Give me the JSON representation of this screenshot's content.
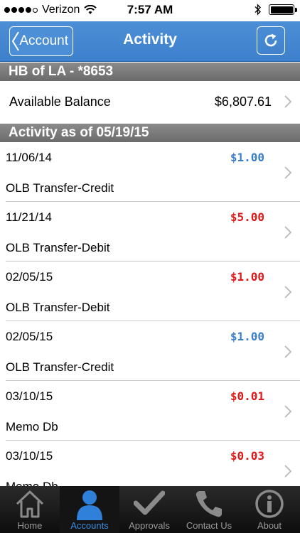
{
  "status_bar": {
    "carrier": "Verizon",
    "time": "7:57 AM"
  },
  "nav": {
    "back_label": "Account",
    "title": "Activity"
  },
  "account_header": "HB of LA - *8653",
  "balance": {
    "label": "Available Balance",
    "value": "$6,807.61"
  },
  "activity_header": "Activity as of 05/19/15",
  "transactions": [
    {
      "date": "11/06/14",
      "description": "OLB Transfer-Credit",
      "amount": "$1.00",
      "type": "credit"
    },
    {
      "date": "11/21/14",
      "description": "OLB Transfer-Debit",
      "amount": "$5.00",
      "type": "debit"
    },
    {
      "date": "02/05/15",
      "description": "OLB Transfer-Debit",
      "amount": "$1.00",
      "type": "debit"
    },
    {
      "date": "02/05/15",
      "description": "OLB Transfer-Credit",
      "amount": "$1.00",
      "type": "credit"
    },
    {
      "date": "03/10/15",
      "description": "Memo Db",
      "amount": "$0.01",
      "type": "debit"
    },
    {
      "date": "03/10/15",
      "description": "Memo Db",
      "amount": "$0.03",
      "type": "debit"
    }
  ],
  "tabs": [
    {
      "label": "Home",
      "icon": "home-icon",
      "active": false
    },
    {
      "label": "Accounts",
      "icon": "person-icon",
      "active": true
    },
    {
      "label": "Approvals",
      "icon": "checkmark-icon",
      "active": false
    },
    {
      "label": "Contact Us",
      "icon": "phone-icon",
      "active": false
    },
    {
      "label": "About",
      "icon": "info-icon",
      "active": false
    }
  ],
  "colors": {
    "nav_blue": "#4d8fd6",
    "credit": "#3a7fc8",
    "debit": "#e01818",
    "active_tab": "#3b8ee0"
  }
}
